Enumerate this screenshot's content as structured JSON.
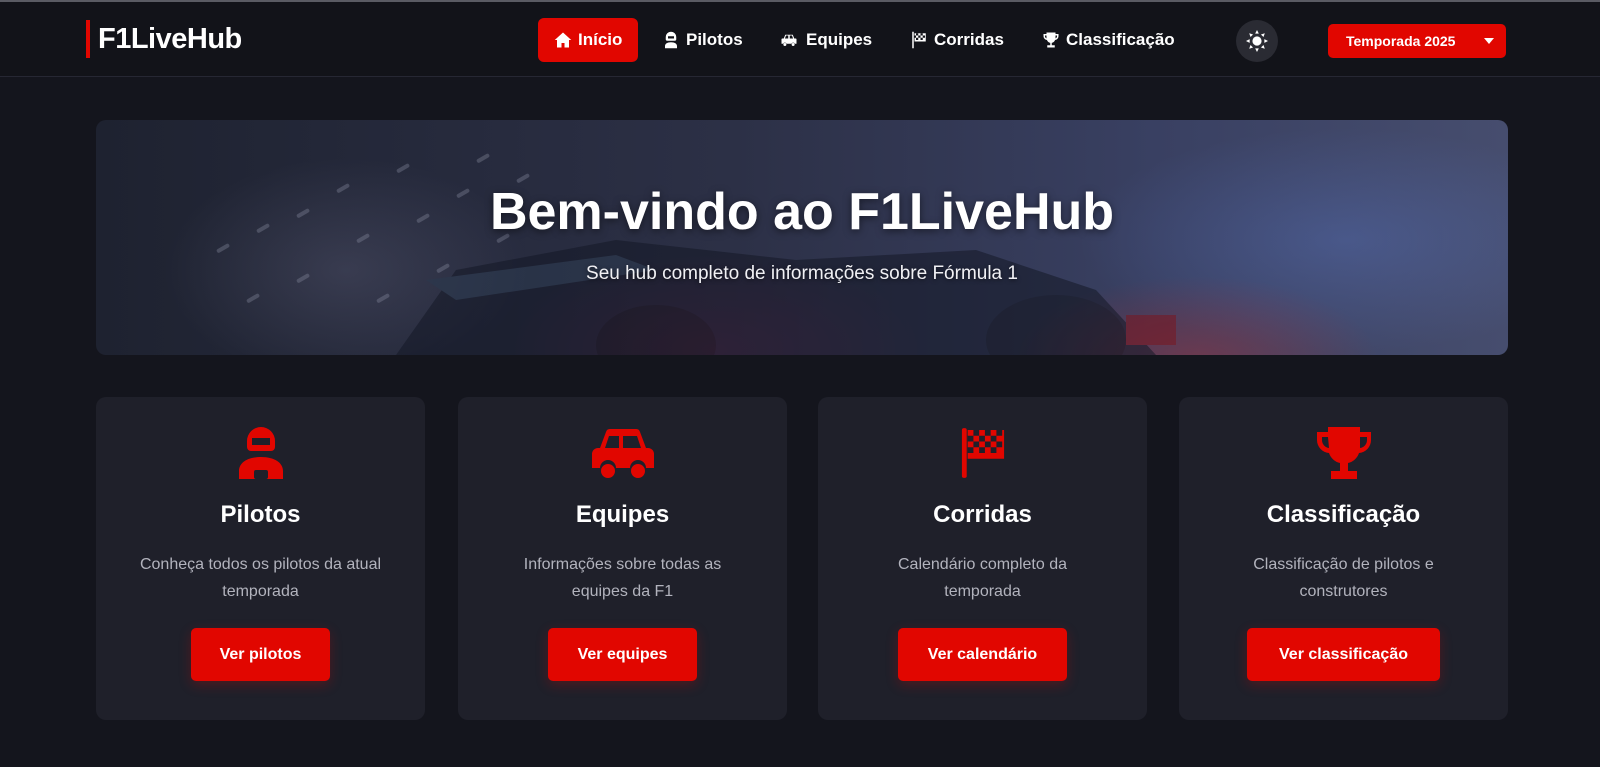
{
  "brand": {
    "name": "F1LiveHub",
    "accent_color": "#e10600"
  },
  "nav": {
    "items": [
      {
        "label": "Início",
        "icon": "home-icon",
        "active": true
      },
      {
        "label": "Pilotos",
        "icon": "driver-icon",
        "active": false
      },
      {
        "label": "Equipes",
        "icon": "car-icon",
        "active": false
      },
      {
        "label": "Corridas",
        "icon": "checkered-flag-icon",
        "active": false
      },
      {
        "label": "Classificação",
        "icon": "trophy-icon",
        "active": false
      }
    ],
    "theme_toggle_icon": "sun-icon",
    "season_label": "Temporada 2025"
  },
  "hero": {
    "title": "Bem-vindo ao F1LiveHub",
    "subtitle": "Seu hub completo de informações sobre Fórmula 1"
  },
  "cards": [
    {
      "icon": "driver-icon",
      "title": "Pilotos",
      "description": "Conheça todos os pilotos da atual temporada",
      "button": "Ver pilotos"
    },
    {
      "icon": "car-icon",
      "title": "Equipes",
      "description": "Informações sobre todas as equipes da F1",
      "button": "Ver equipes"
    },
    {
      "icon": "checkered-flag-icon",
      "title": "Corridas",
      "description": "Calendário completo da temporada",
      "button": "Ver calendário"
    },
    {
      "icon": "trophy-icon",
      "title": "Classificação",
      "description": "Classificação de pilotos e construtores",
      "button": "Ver classificação"
    }
  ]
}
